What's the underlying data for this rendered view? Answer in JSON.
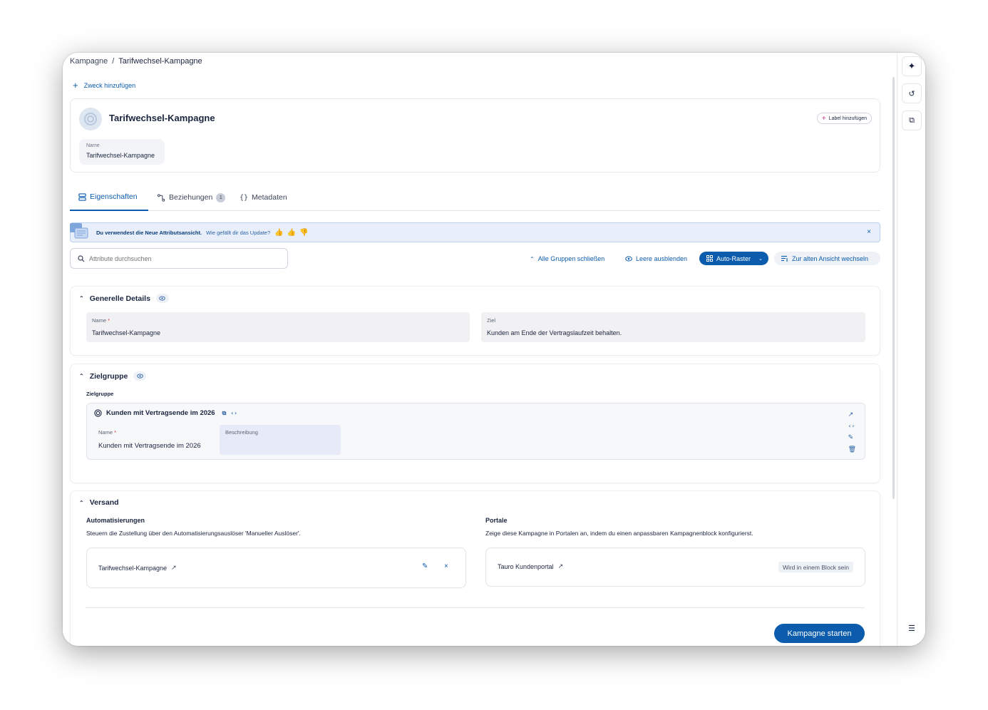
{
  "breadcrumb": {
    "parent": "Kampagne",
    "separator": "/",
    "current": "Tarifwechsel-Kampagne"
  },
  "add_purpose": "Zweck hinzufügen",
  "header": {
    "title": "Tarifwechsel-Kampagne",
    "label_button": "Label hinzufügen",
    "name_label": "Name",
    "name_value": "Tarifwechsel-Kampagne"
  },
  "tabs": [
    {
      "label": "Eigenschaften",
      "active": true
    },
    {
      "label": "Beziehungen",
      "badge": "1"
    },
    {
      "label": "Metadaten"
    }
  ],
  "banner": {
    "message": "Du verwendest die Neue Attributsansicht.",
    "question": "Wie gefällt dir das Update?",
    "close": "×"
  },
  "search": {
    "placeholder": "Attribute durchsuchen"
  },
  "toolbar": {
    "collapse_all": "Alle Gruppen schließen",
    "hide_empty": "Leere ausblenden",
    "auto_raster": "Auto-Raster",
    "old_view": "Zur alten Ansicht wechseln"
  },
  "general": {
    "title": "Generelle Details",
    "name_label": "Name",
    "required_mark": "*",
    "name_value": "Tarifwechsel-Kampagne",
    "goal_label": "Ziel",
    "goal_value": "Kunden am Ende der Vertragslaufzeit behalten."
  },
  "audience": {
    "title": "Zielgruppe",
    "sub_label": "Zielgruppe",
    "card_title": "Kunden mit Vertragsende im 2026",
    "name_label": "Name",
    "required_mark": "*",
    "name_value": "Kunden mit Vertragsende im 2026",
    "desc_label": "Beschreibung"
  },
  "dispatch": {
    "title": "Versand",
    "automations_title": "Automatisierungen",
    "automations_desc": "Steuern die Zustellung über den Automatisierungsauslöser 'Manueller Auslöser'.",
    "automation_item": "Tarifwechsel-Kampagne",
    "portals_title": "Portale",
    "portals_desc": "Zeige diese Kampagne in Portalen an, indem du einen anpassbaren Kampagnenblock konfigurierst.",
    "portal_item": "Tauro Kundenportal",
    "portal_status": "Wird in einem Block sein"
  },
  "start_button": "Kampagne starten",
  "colors": {
    "primary": "#0b5cad",
    "banner_bg": "#e8effb",
    "field_bg": "#f1f1f3",
    "text": "#1b2540"
  }
}
